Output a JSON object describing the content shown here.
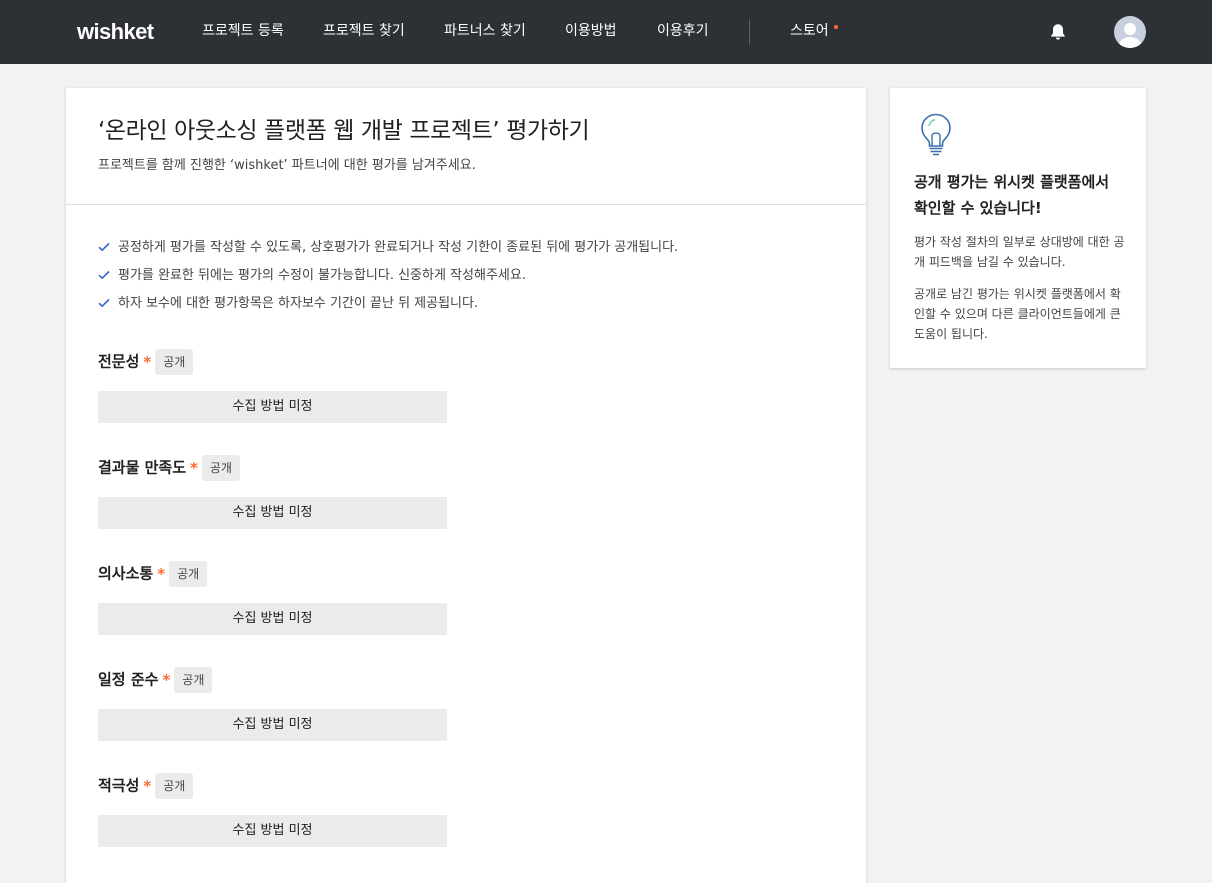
{
  "header": {
    "logo": "wishket",
    "nav": [
      "프로젝트 등록",
      "프로젝트 찾기",
      "파트너스 찾기",
      "이용방법",
      "이용후기"
    ],
    "store": "스토어",
    "accent_color": "#ff6a2d",
    "background_color": "#2d3035"
  },
  "main": {
    "title": "‘온라인 아웃소싱 플랫폼 웹 개발 프로젝트’ 평가하기",
    "subtitle": "프로젝트를 함께 진행한 ‘wishket’ 파트너에 대한 평가를 남겨주세요.",
    "notices": [
      "공정하게 평가를 작성할 수 있도록, 상호평가가 완료되거나 작성 기한이 종료된 뒤에 평가가 공개됩니다.",
      "평가를 완료한 뒤에는 평가의 수정이 불가능합니다. 신중하게 작성해주세요.",
      "하자 보수에 대한 평가항목은 하자보수 기간이 끝난 뒤 제공됩니다."
    ],
    "sections": [
      {
        "title": "전문성",
        "required": "*",
        "badge": "공개",
        "collect": "수집 방법 미정"
      },
      {
        "title": "결과물 만족도",
        "required": "*",
        "badge": "공개",
        "collect": "수집 방법 미정"
      },
      {
        "title": "의사소통",
        "required": "*",
        "badge": "공개",
        "collect": "수집 방법 미정"
      },
      {
        "title": "일정 준수",
        "required": "*",
        "badge": "공개",
        "collect": "수집 방법 미정"
      },
      {
        "title": "적극성",
        "required": "*",
        "badge": "공개",
        "collect": "수집 방법 미정"
      }
    ]
  },
  "side": {
    "heading": "공개 평가는 위시켓 플랫폼에서 확인할 수 있습니다!",
    "paragraphs": [
      "평가 작성 절차의 일부로 상대방에 대한 공개 피드백을 남길 수 있습니다.",
      "공개로 남긴 평가는 위시켓 플랫폼에서 확인할 수 있으며 다른 클라이언트들에게 큰 도움이 됩니다."
    ]
  },
  "icons": [
    "bell-icon",
    "avatar",
    "lightbulb-icon",
    "check-icon"
  ]
}
